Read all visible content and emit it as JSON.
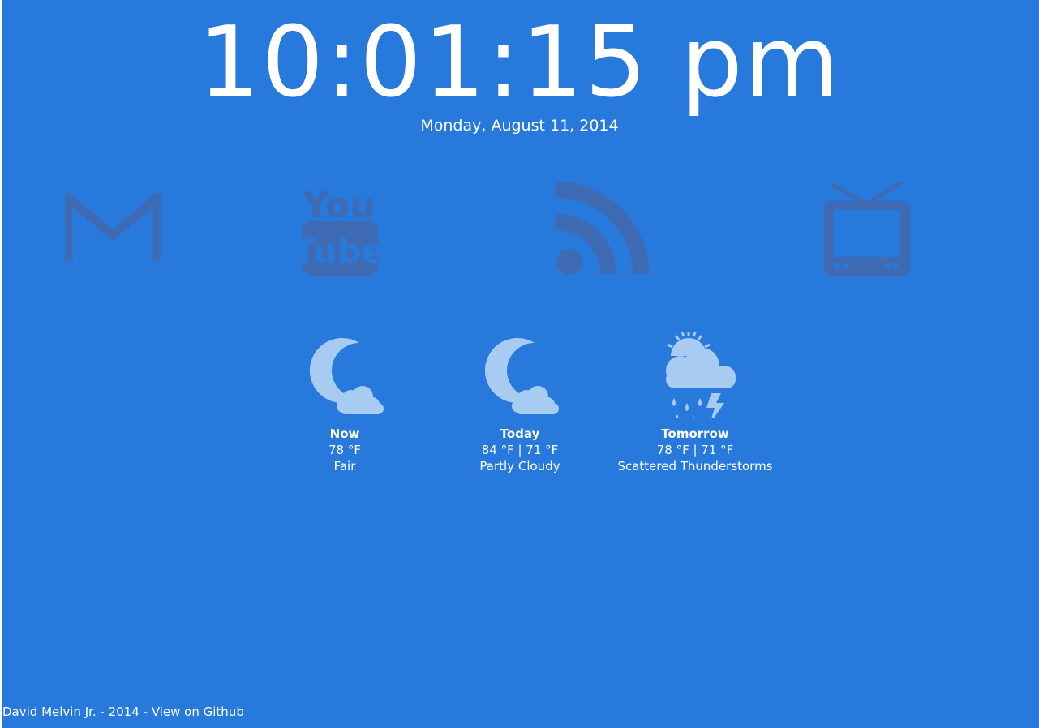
{
  "clock": {
    "time": "10:01:15 pm",
    "date": "Monday, August 11, 2014"
  },
  "apps": [
    {
      "name": "Gmail",
      "icon": "gmail-icon"
    },
    {
      "name": "YouTube",
      "icon": "youtube-icon",
      "logo_top": "You",
      "logo_bottom": "Tube"
    },
    {
      "name": "RSS Feed",
      "icon": "rss-icon"
    },
    {
      "name": "TV",
      "icon": "tv-icon"
    }
  ],
  "weather": [
    {
      "label": "Now",
      "temp": "78 °F",
      "condition": "Fair",
      "icon": "moon-cloud-icon"
    },
    {
      "label": "Today",
      "temp": "84 °F | 71 °F",
      "condition": "Partly Cloudy",
      "icon": "moon-cloud-icon"
    },
    {
      "label": "Tomorrow",
      "temp": "78 °F | 71 °F",
      "condition": "Scattered Thunderstorms",
      "icon": "thunderstorm-icon"
    }
  ],
  "footer": {
    "author": "David Melvin Jr.",
    "separator": " - ",
    "year": "2014",
    "link": "View on Github"
  },
  "colors": {
    "background": "#2779DB",
    "icon_dim": "#3F6BB4",
    "weather_icon": "#A8CBF2",
    "text": "#FFFFFF"
  }
}
